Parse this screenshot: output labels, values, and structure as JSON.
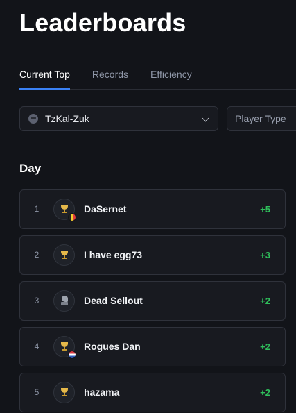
{
  "page": {
    "title": "Leaderboards"
  },
  "tabs": [
    {
      "label": "Current Top",
      "active": true
    },
    {
      "label": "Records",
      "active": false
    },
    {
      "label": "Efficiency",
      "active": false
    }
  ],
  "filters": {
    "boss": {
      "value": "TzKal-Zuk",
      "icon": "tzkal-zuk-icon"
    },
    "player_type": {
      "placeholder": "Player Type"
    }
  },
  "section": {
    "title": "Day"
  },
  "colors": {
    "accent": "#3b82f6",
    "positive": "#2fbf5b",
    "trophy": "#e6b94a"
  },
  "entries": [
    {
      "rank": "1",
      "name": "DaSernet",
      "delta": "+5",
      "icon": "trophy-icon",
      "flag": "belgium-flag-icon"
    },
    {
      "rank": "2",
      "name": "I have egg73",
      "delta": "+3",
      "icon": "trophy-icon",
      "flag": ""
    },
    {
      "rank": "3",
      "name": "Dead Sellout",
      "delta": "+2",
      "icon": "knight-icon",
      "flag": ""
    },
    {
      "rank": "4",
      "name": "Rogues Dan",
      "delta": "+2",
      "icon": "trophy-icon",
      "flag": "netherlands-flag-icon"
    },
    {
      "rank": "5",
      "name": "hazama",
      "delta": "+2",
      "icon": "trophy-icon",
      "flag": ""
    }
  ]
}
